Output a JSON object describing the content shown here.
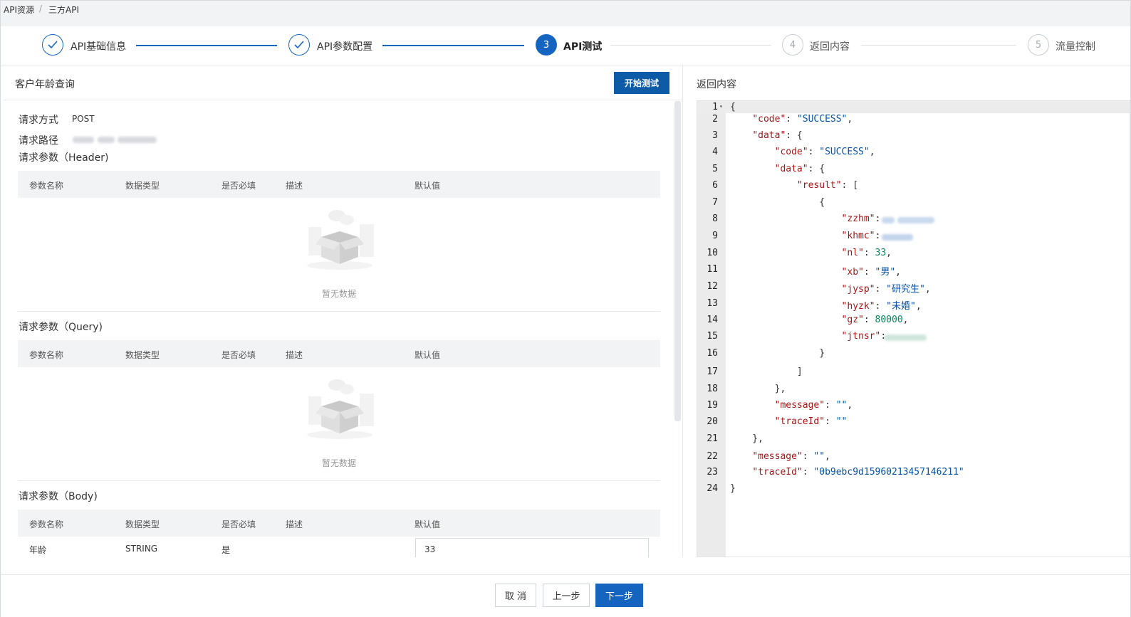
{
  "breadcrumb": {
    "root": "API资源",
    "separator": "/",
    "current": "三方API"
  },
  "steps": [
    {
      "index": "1",
      "label": "API基础信息",
      "state": "done"
    },
    {
      "index": "2",
      "label": "API参数配置",
      "state": "done"
    },
    {
      "index": "3",
      "label": "API测试",
      "state": "active"
    },
    {
      "index": "4",
      "label": "返回内容",
      "state": "todo"
    },
    {
      "index": "5",
      "label": "流量控制",
      "state": "todo"
    }
  ],
  "left": {
    "title": "客户年龄查询",
    "start_button": "开始测试",
    "method_label": "请求方式",
    "method_value": "POST",
    "path_label": "请求路径",
    "columns": [
      "参数名称",
      "数据类型",
      "是否必填",
      "描述",
      "默认值"
    ],
    "header_section": {
      "title": "请求参数（Header)",
      "empty_text": "暂无数据"
    },
    "query_section": {
      "title": "请求参数（Query)",
      "empty_text": "暂无数据"
    },
    "body_section": {
      "title": "请求参数（Body)",
      "row": {
        "name": "年龄",
        "type": "STRING",
        "required": "是",
        "default": "33"
      }
    }
  },
  "right": {
    "title": "返回内容"
  },
  "response_lines": [
    [
      [
        "p",
        "{"
      ]
    ],
    [
      [
        "p",
        "    "
      ],
      [
        "k",
        "\"code\""
      ],
      [
        "p",
        ": "
      ],
      [
        "s",
        "\"SUCCESS\""
      ],
      [
        "p",
        ","
      ]
    ],
    [
      [
        "p",
        "    "
      ],
      [
        "k",
        "\"data\""
      ],
      [
        "p",
        ": {"
      ]
    ],
    [
      [
        "p",
        "        "
      ],
      [
        "k",
        "\"code\""
      ],
      [
        "p",
        ": "
      ],
      [
        "s",
        "\"SUCCESS\""
      ],
      [
        "p",
        ","
      ]
    ],
    [
      [
        "p",
        "        "
      ],
      [
        "k",
        "\"data\""
      ],
      [
        "p",
        ": {"
      ]
    ],
    [
      [
        "p",
        "            "
      ],
      [
        "k",
        "\"result\""
      ],
      [
        "p",
        ": ["
      ]
    ],
    [
      [
        "p",
        "                {"
      ]
    ],
    [
      [
        "p",
        "                    "
      ],
      [
        "k",
        "\"zzhm\""
      ],
      [
        "p",
        ": "
      ]
    ],
    [
      [
        "p",
        "                    "
      ],
      [
        "k",
        "\"khmc\""
      ],
      [
        "p",
        ": "
      ]
    ],
    [
      [
        "p",
        "                    "
      ],
      [
        "k",
        "\"nl\""
      ],
      [
        "p",
        ": "
      ],
      [
        "n",
        "33"
      ],
      [
        "p",
        ","
      ]
    ],
    [
      [
        "p",
        "                    "
      ],
      [
        "k",
        "\"xb\""
      ],
      [
        "p",
        ": "
      ],
      [
        "s",
        "\"男\""
      ],
      [
        "p",
        ","
      ]
    ],
    [
      [
        "p",
        "                    "
      ],
      [
        "k",
        "\"jysp\""
      ],
      [
        "p",
        ": "
      ],
      [
        "s",
        "\"研究生\""
      ],
      [
        "p",
        ","
      ]
    ],
    [
      [
        "p",
        "                    "
      ],
      [
        "k",
        "\"hyzk\""
      ],
      [
        "p",
        ": "
      ],
      [
        "s",
        "\"未婚\""
      ],
      [
        "p",
        ","
      ]
    ],
    [
      [
        "p",
        "                    "
      ],
      [
        "k",
        "\"gz\""
      ],
      [
        "p",
        ": "
      ],
      [
        "n",
        "80000"
      ],
      [
        "p",
        ","
      ]
    ],
    [
      [
        "p",
        "                    "
      ],
      [
        "k",
        "\"jtnsr\""
      ],
      [
        "p",
        ": "
      ]
    ],
    [
      [
        "p",
        "                }"
      ]
    ],
    [
      [
        "p",
        "            ]"
      ]
    ],
    [
      [
        "p",
        "        },"
      ]
    ],
    [
      [
        "p",
        "        "
      ],
      [
        "k",
        "\"message\""
      ],
      [
        "p",
        ": "
      ],
      [
        "s",
        "\"\""
      ],
      [
        "p",
        ","
      ]
    ],
    [
      [
        "p",
        "        "
      ],
      [
        "k",
        "\"traceId\""
      ],
      [
        "p",
        ": "
      ],
      [
        "s",
        "\"\""
      ]
    ],
    [
      [
        "p",
        "    },"
      ]
    ],
    [
      [
        "p",
        "    "
      ],
      [
        "k",
        "\"message\""
      ],
      [
        "p",
        ": "
      ],
      [
        "s",
        "\"\""
      ],
      [
        "p",
        ","
      ]
    ],
    [
      [
        "p",
        "    "
      ],
      [
        "k",
        "\"traceId\""
      ],
      [
        "p",
        ": "
      ],
      [
        "s",
        "\"0b9ebc9d15960213457146211\""
      ]
    ],
    [
      [
        "p",
        "}"
      ]
    ]
  ],
  "footer": {
    "cancel": "取 消",
    "prev": "上一步",
    "next": "下一步"
  },
  "colors": {
    "primary": "#1565c0",
    "button_dark": "#0d5aa7",
    "json_key": "#a31515",
    "json_string": "#0451a5",
    "json_number": "#098658"
  }
}
